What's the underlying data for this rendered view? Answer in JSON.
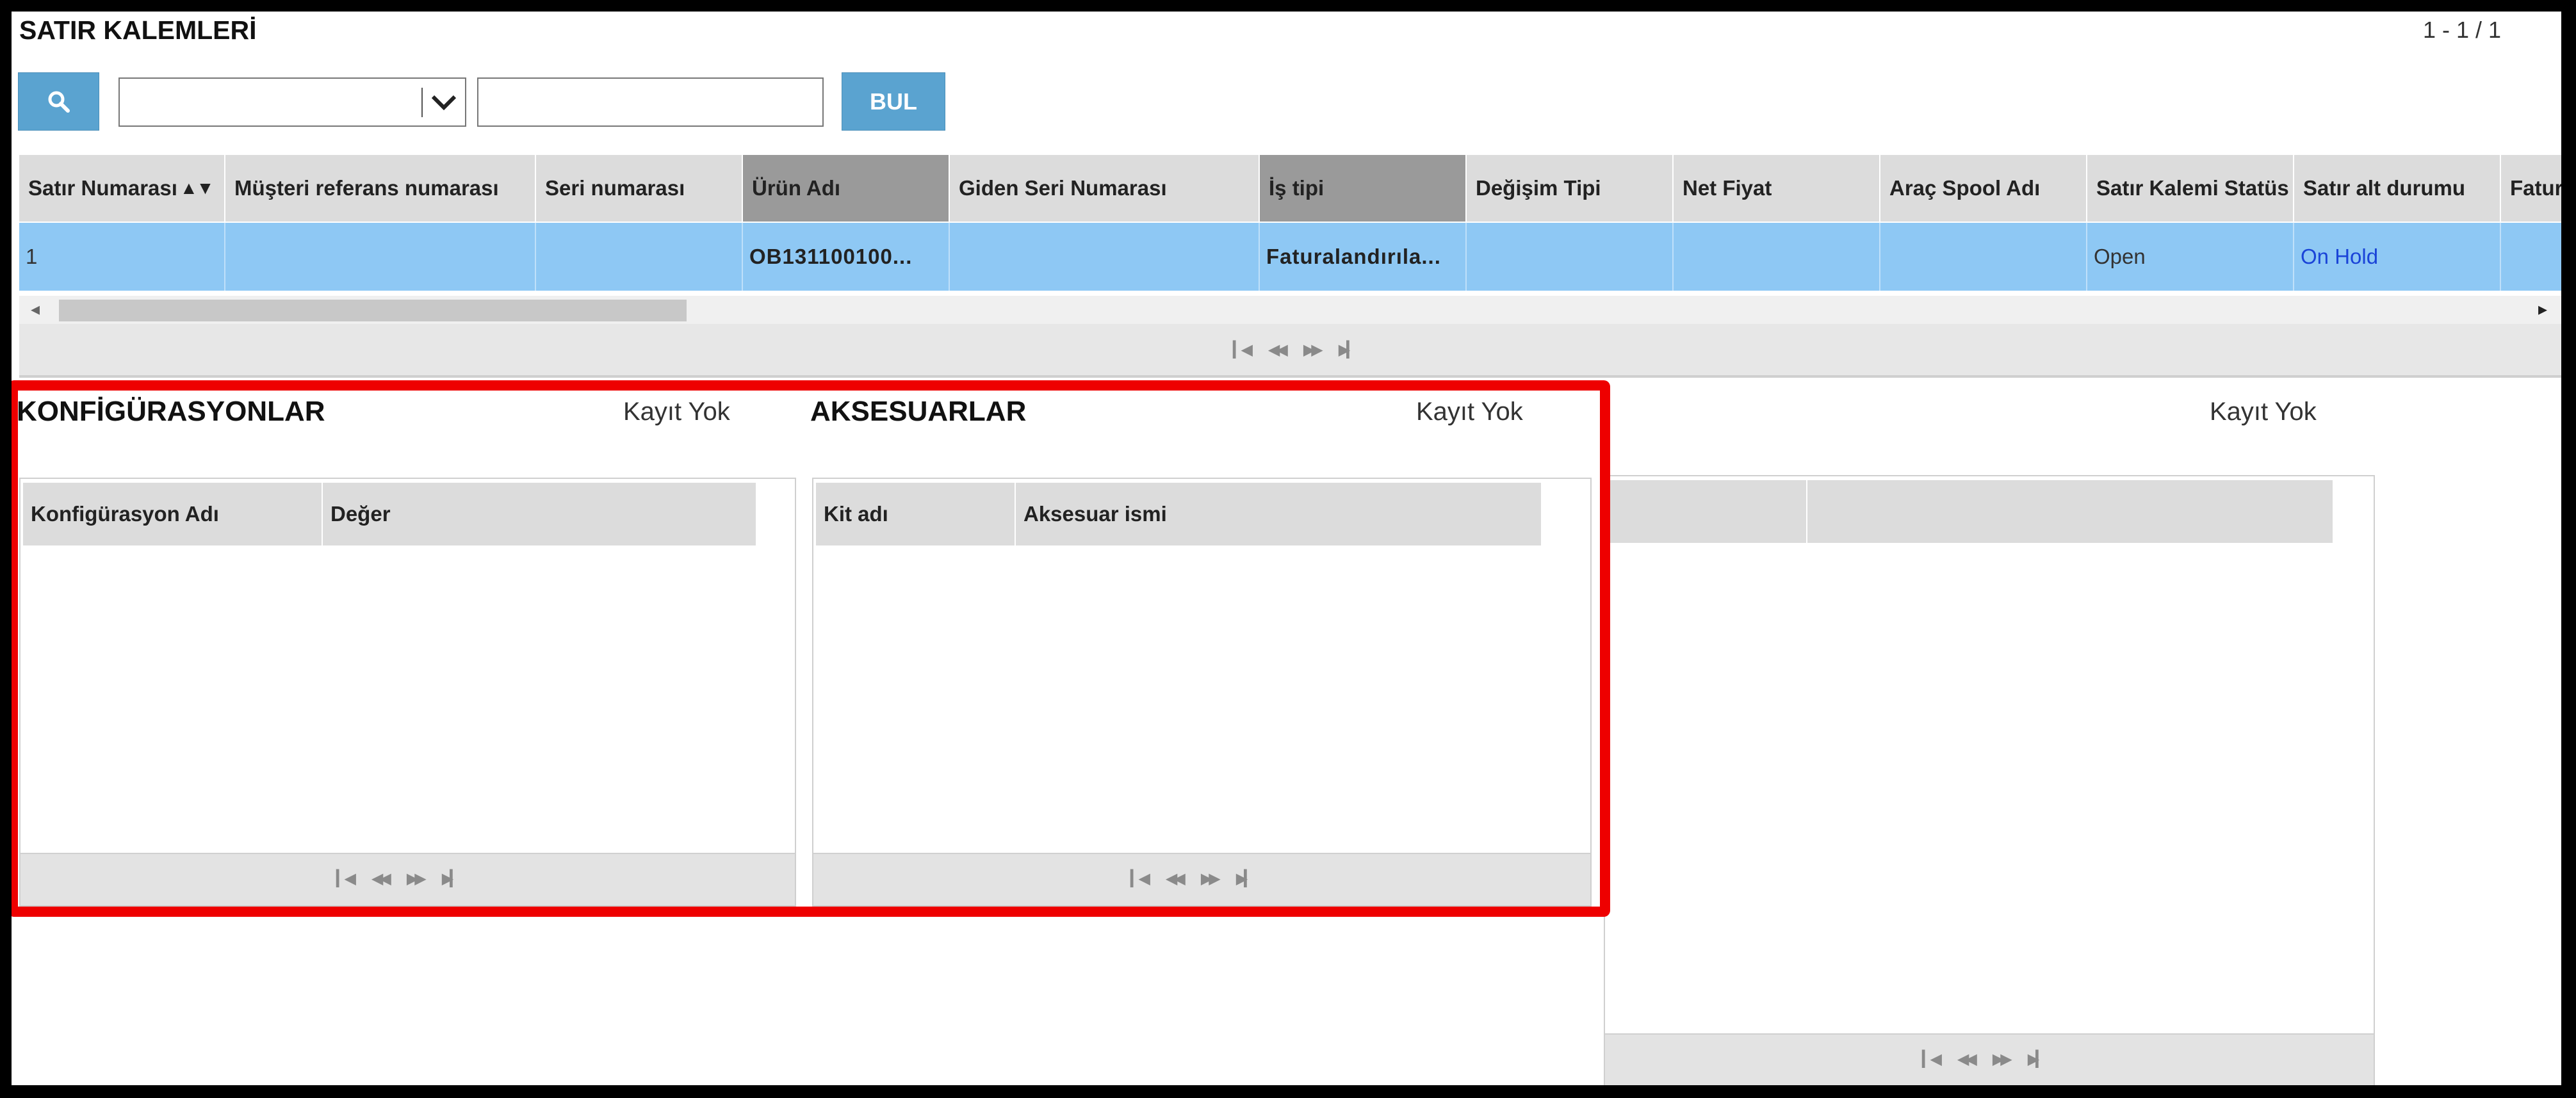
{
  "header": {
    "title": "SATIR KALEMLERİ",
    "record_count": "1 - 1 / 1"
  },
  "toolbar": {
    "search_icon": "search-icon",
    "dropdown_value": "",
    "search_value": "",
    "find_label": "BUL"
  },
  "grid": {
    "columns": [
      "Satır Numarası",
      "Müşteri referans numarası",
      "Seri numarası",
      "Ürün Adı",
      "Giden Seri Numarası",
      "İş tipi",
      "Değişim Tipi",
      "Net Fiyat",
      "Araç Spool Adı",
      "Satır Kalemi Statüs",
      "Satır alt durumu",
      "Fatur"
    ],
    "sort_indicator": "▲▼",
    "rows": [
      {
        "satir_no": "1",
        "musteri_ref": "",
        "seri_no": "",
        "urun_adi": "OB131100100...",
        "giden_seri": "",
        "is_tipi": "Faturalandırıla...",
        "degisim_tipi": "",
        "net_fiyat": "",
        "arac_spool": "",
        "kalem_status": "Open",
        "alt_durum": "On Hold",
        "fatura": ""
      }
    ],
    "selected_row_color": "#8ec8f4"
  },
  "pager_icons": [
    "first-page-icon",
    "prev-page-icon",
    "next-page-icon",
    "last-page-icon"
  ],
  "panels": {
    "configurations": {
      "title": "KONFİGÜRASYONLAR",
      "empty_text": "Kayıt Yok",
      "columns": [
        "Konfigürasyon Adı",
        "Değer"
      ]
    },
    "accessories": {
      "title": "AKSESUARLAR",
      "empty_text": "Kayıt Yok",
      "columns": [
        "Kit adı",
        "Aksesuar ismi"
      ]
    },
    "third": {
      "title": "",
      "empty_text": "Kayıt Yok",
      "columns": [
        "",
        ""
      ]
    }
  },
  "colors": {
    "accent_button": "#5aa3d0",
    "highlight_box": "#ee0000",
    "link": "#1a44d8"
  }
}
